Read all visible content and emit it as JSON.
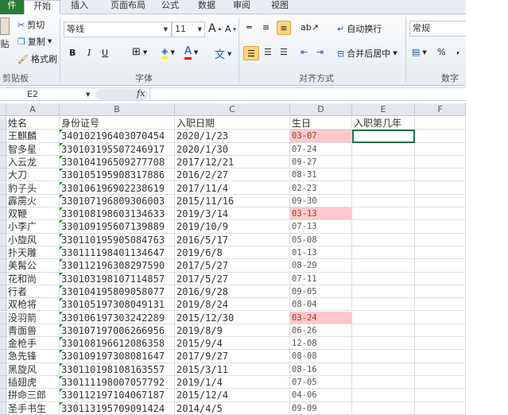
{
  "tabs": [
    "件",
    "开始",
    "插入",
    "页面布局",
    "公式",
    "数据",
    "审阅",
    "视图"
  ],
  "clipboard": {
    "paste": "贴",
    "cut": "剪切",
    "copy": "复制",
    "format_painter": "格式刷",
    "label": "剪贴板"
  },
  "font": {
    "name": "等线",
    "size": "11",
    "bold": "B",
    "italic": "I",
    "underline": "U",
    "label": "字体",
    "fill_color": "#ffff00",
    "font_color": "#e00000"
  },
  "alignment": {
    "wrap": "自动换行",
    "merge": "合并后居中",
    "label": "对齐方式"
  },
  "number": {
    "format": "常规",
    "percent": "%",
    "comma": ",",
    "label": "数字"
  },
  "formula_bar": {
    "name_box": "E2",
    "fx": "fx",
    "value": ""
  },
  "columns": [
    "A",
    "B",
    "C",
    "D",
    "E",
    "F"
  ],
  "headers": [
    "姓名",
    "身份证号",
    "入职日期",
    "生日",
    "入职第几年"
  ],
  "rows": [
    [
      "王麒麟",
      "340102196403070454",
      "2020/1/23",
      "03-07",
      true
    ],
    [
      "智多星",
      "330103195507246917",
      "2020/1/30",
      "07-24",
      false
    ],
    [
      "入云龙",
      "330104196509277708",
      "2017/12/21",
      "09-27",
      false
    ],
    [
      "大刀",
      "330105195908317886",
      "2016/2/27",
      "08-31",
      false
    ],
    [
      "豹子头",
      "330106196902238619",
      "2017/11/4",
      "02-23",
      false
    ],
    [
      "霹雳火",
      "330107196809306003",
      "2015/11/16",
      "09-30",
      false
    ],
    [
      "双鞭",
      "330108198603134633",
      "2019/3/14",
      "03-13",
      true
    ],
    [
      "小李广",
      "330109195607139889",
      "2019/10/9",
      "07-13",
      false
    ],
    [
      "小旋风",
      "330110195905084763",
      "2016/5/17",
      "05-08",
      false
    ],
    [
      "扑天雕",
      "330111198401134647",
      "2019/6/8",
      "01-13",
      false
    ],
    [
      "美髯公",
      "330112196308297590",
      "2017/5/27",
      "08-29",
      false
    ],
    [
      "花和尚",
      "330103198107114857",
      "2017/5/27",
      "07-11",
      false
    ],
    [
      "行者",
      "330104195809058077",
      "2016/9/28",
      "09-05",
      false
    ],
    [
      "双枪将",
      "330105197308049131",
      "2019/8/24",
      "08-04",
      false
    ],
    [
      "没羽箭",
      "330106197303242289",
      "2015/12/30",
      "03-24",
      true
    ],
    [
      "青面兽",
      "330107197006266956",
      "2019/8/9",
      "06-26",
      false
    ],
    [
      "金枪手",
      "330108196612086358",
      "2015/9/4",
      "12-08",
      false
    ],
    [
      "急先锋",
      "330109197308081647",
      "2017/9/27",
      "08-08",
      false
    ],
    [
      "黑旋风",
      "330110198108163557",
      "2015/3/11",
      "08-16",
      false
    ],
    [
      "插翅虎",
      "330111198007057792",
      "2019/1/4",
      "07-05",
      false
    ],
    [
      "拼命三郎",
      "330112197104067187",
      "2015/12/4",
      "04-06",
      false
    ],
    [
      "圣手书生",
      "330113195709091424",
      "2014/4/5",
      "09-09",
      false
    ]
  ]
}
